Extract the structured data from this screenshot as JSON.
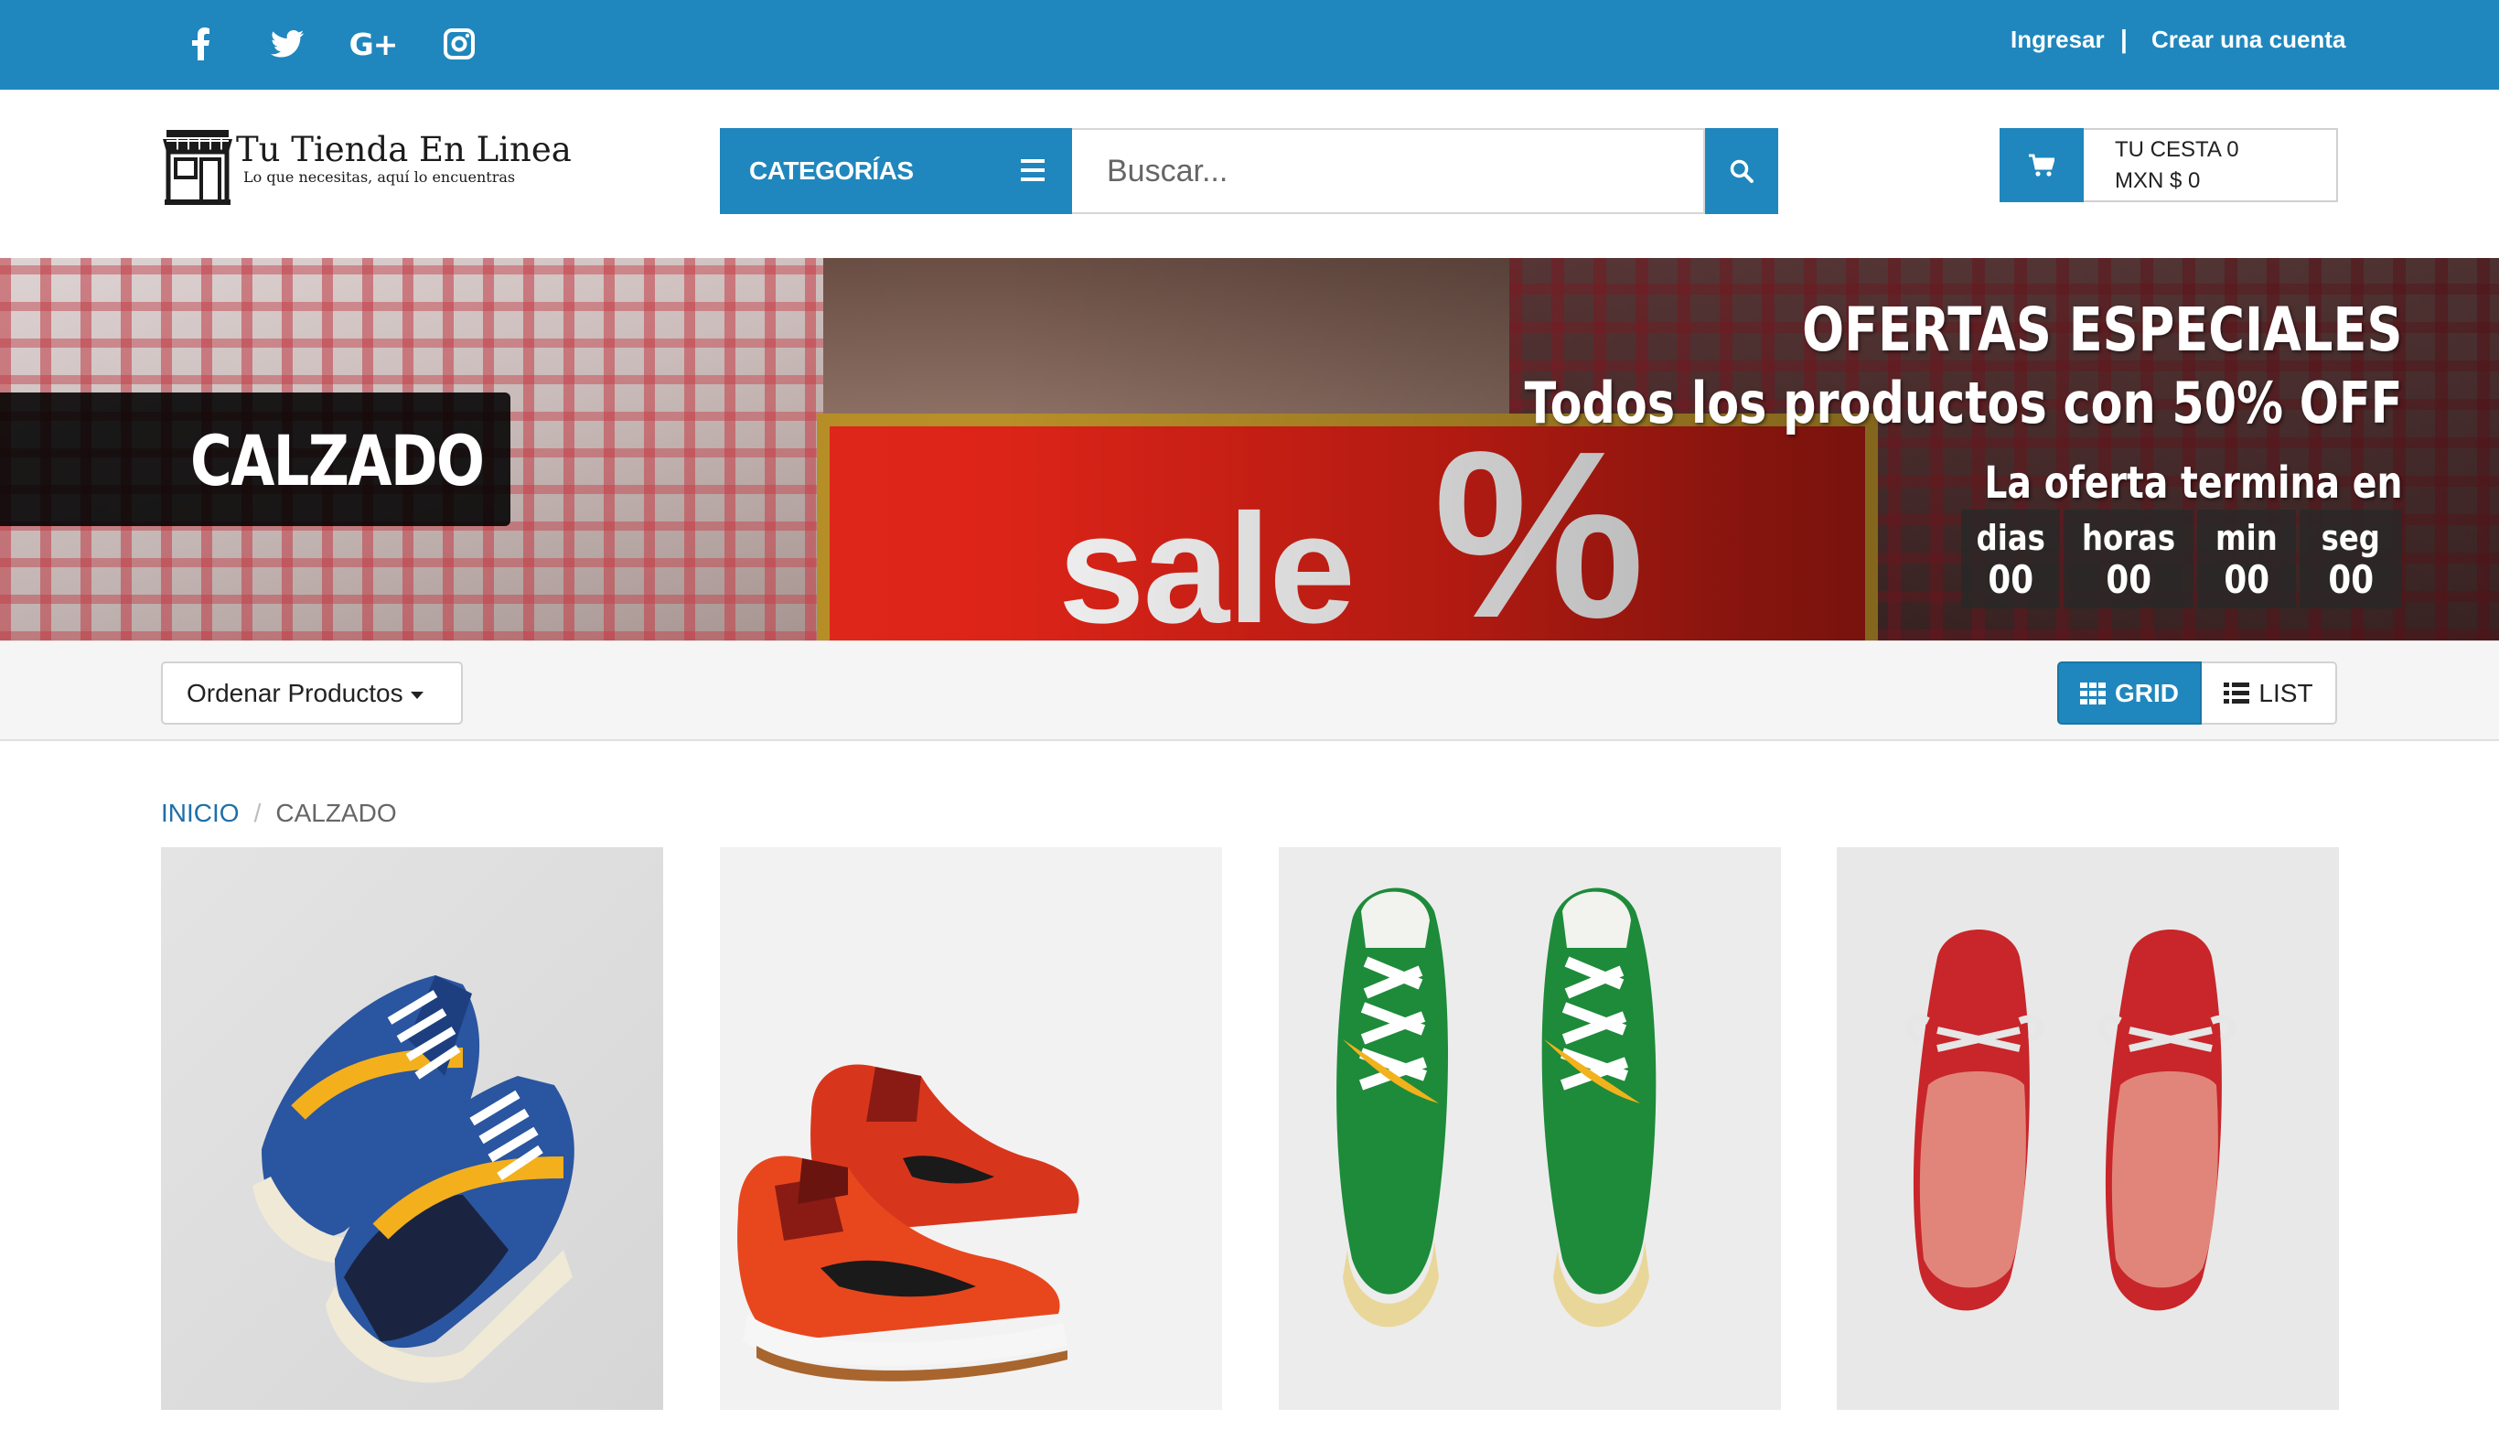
{
  "topbar": {
    "social": [
      {
        "name": "facebook-icon",
        "glyph": "f"
      },
      {
        "name": "twitter-icon",
        "glyph": "twitter"
      },
      {
        "name": "google-plus-icon",
        "glyph": "G+"
      },
      {
        "name": "instagram-icon",
        "glyph": "instagram"
      }
    ],
    "login": "Ingresar",
    "separator": "|",
    "register": "Crear una cuenta"
  },
  "header": {
    "logo_title": "Tu Tienda En Linea",
    "logo_subtitle": "Lo que necesitas, aquí lo encuentras",
    "categories_label": "CATEGORÍAS",
    "search_placeholder": "Buscar...",
    "cart_line1": "TU CESTA 0",
    "cart_line2": "MXN $ 0"
  },
  "hero": {
    "sign_word": "sale",
    "sign_symbol": "%",
    "category": "CALZADO",
    "offer_title": "OFERTAS ESPECIALES",
    "offer_subtitle": "Todos los productos con 50% OFF",
    "offer_ends": "La oferta termina en",
    "countdown": [
      {
        "label": "dias",
        "value": "00"
      },
      {
        "label": "horas",
        "value": "00"
      },
      {
        "label": "min",
        "value": "00"
      },
      {
        "label": "seg",
        "value": "00"
      }
    ]
  },
  "toolbar": {
    "sort_label": "Ordenar Productos",
    "grid_label": "GRID",
    "list_label": "LIST"
  },
  "breadcrumb": {
    "home": "INICIO",
    "separator": "/",
    "current": "CALZADO"
  },
  "products": [
    {
      "name": "product-sneaker-blue-vans"
    },
    {
      "name": "product-sneaker-red-nike-high"
    },
    {
      "name": "product-sneaker-green-nike"
    },
    {
      "name": "product-boat-shoe-red"
    }
  ],
  "colors": {
    "brand_blue": "#1f87bd",
    "toolbar_bg": "#f5f5f5",
    "breadcrumb_link": "#1f6fa8"
  }
}
